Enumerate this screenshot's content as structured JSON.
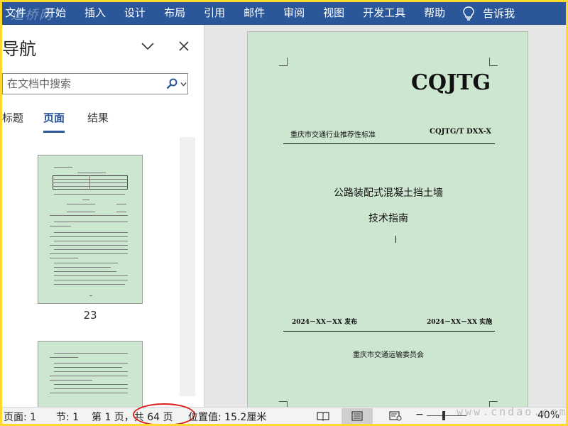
{
  "ribbon": {
    "tabs": [
      "文件",
      "开始",
      "插入",
      "设计",
      "布局",
      "引用",
      "邮件",
      "审阅",
      "视图",
      "开发工具",
      "帮助"
    ],
    "tell_me": "告诉我",
    "bulb_icon": "lightbulb-icon",
    "watermark": "道桥网"
  },
  "nav": {
    "title": "导航",
    "search_placeholder": "在文档中搜索",
    "tabs": [
      "标题",
      "页面",
      "结果"
    ],
    "active_tab": "页面",
    "thumb_page_number": "23"
  },
  "document": {
    "logo": "CQJTG",
    "standard_type": "重庆市交通行业推荐性标准",
    "code": "CQJTG/T DXX-X",
    "title_line1": "公路装配式混凝土挡土墙",
    "title_line2": "技术指南",
    "issue_date": "2024－XX－XX 发布",
    "implement_date": "2024－XX－XX 实施",
    "issuer": "重庆市交通运输委员会",
    "page_color": "#cde6d0"
  },
  "status": {
    "page": "页面: 1",
    "section": "节: 1",
    "page_of": "第 1 页，共 64 页",
    "position": "位置值: 15.2厘米",
    "zoom": "40%"
  },
  "colors": {
    "ribbon": "#2b579a",
    "highlight_circle": "#d9231e",
    "frame": "#ffd92e"
  },
  "watermark_br": "www.cndao.com"
}
